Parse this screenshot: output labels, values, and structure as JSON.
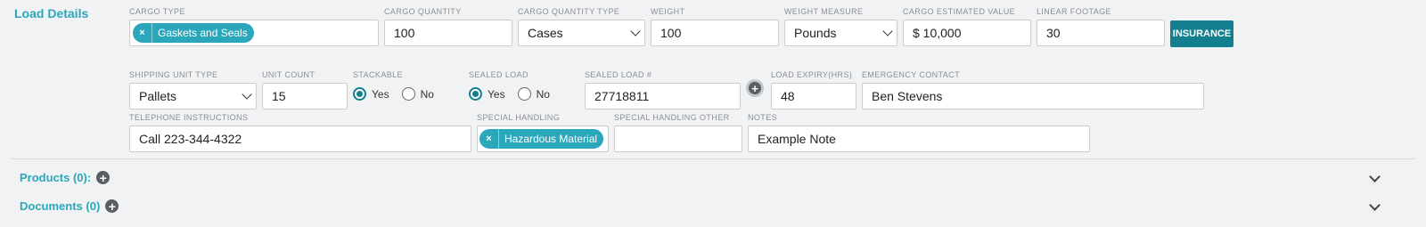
{
  "load_details": {
    "title": "Load Details",
    "cargo_type": {
      "label": "CARGO TYPE",
      "tags": [
        "Gaskets and Seals"
      ]
    },
    "cargo_quantity": {
      "label": "CARGO QUANTITY",
      "value": "100"
    },
    "cargo_quantity_type": {
      "label": "CARGO QUANTITY TYPE",
      "value": "Cases"
    },
    "weight": {
      "label": "WEIGHT",
      "value": "100"
    },
    "weight_measure": {
      "label": "WEIGHT MEASURE",
      "value": "Pounds"
    },
    "cargo_estimated_value": {
      "label": "CARGO ESTIMATED VALUE",
      "value": "$ 10,000"
    },
    "linear_footage": {
      "label": "LINEAR FOOTAGE",
      "value": "30"
    },
    "insurance_button": "INSURANCE",
    "shipping_unit_type": {
      "label": "SHIPPING UNIT TYPE",
      "value": "Pallets"
    },
    "unit_count": {
      "label": "UNIT COUNT",
      "value": "15"
    },
    "stackable": {
      "label": "STACKABLE",
      "yes": "Yes",
      "no": "No",
      "selected": "Yes"
    },
    "sealed_load": {
      "label": "SEALED LOAD",
      "yes": "Yes",
      "no": "No",
      "selected": "Yes"
    },
    "sealed_load_number": {
      "label": "SEALED LOAD #",
      "value": "27718811"
    },
    "load_expiry": {
      "label": "LOAD EXPIRY(HRS)",
      "value": "48"
    },
    "emergency_contact": {
      "label": "EMERGENCY CONTACT",
      "value": "Ben Stevens"
    },
    "telephone_instructions": {
      "label": "TELEPHONE INSTRUCTIONS",
      "value": "Call 223-344-4322"
    },
    "special_handling": {
      "label": "SPECIAL HANDLING",
      "tags": [
        "Hazardous Material"
      ]
    },
    "special_handling_other": {
      "label": "SPECIAL HANDLING OTHER",
      "value": ""
    },
    "notes": {
      "label": "NOTES",
      "value": "Example Note"
    }
  },
  "sections": {
    "products": "Products (0):",
    "documents": "Documents (0)"
  },
  "colors": {
    "accent": "#2aa7bb",
    "button": "#137f8f",
    "background": "#f1f2f3"
  },
  "icons": {
    "tag_remove": "×",
    "plus": "+"
  }
}
